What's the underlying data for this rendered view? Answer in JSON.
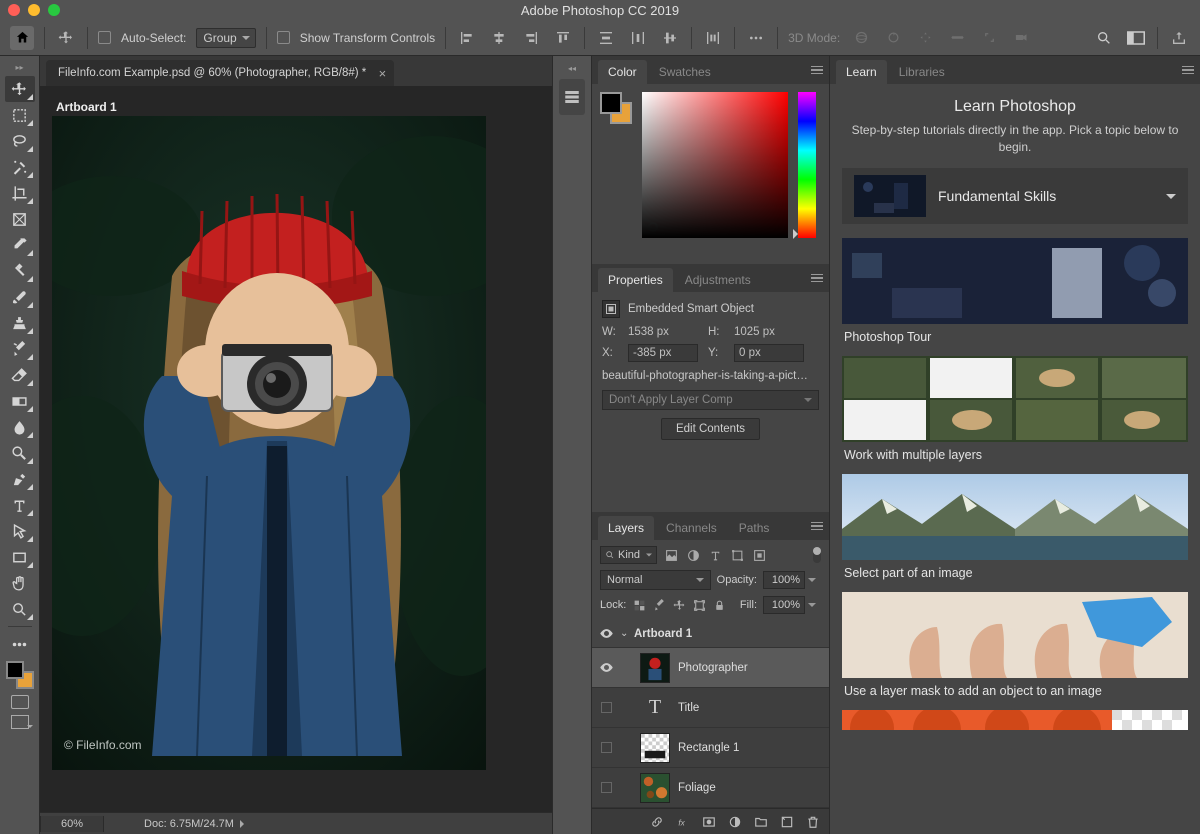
{
  "title": "Adobe Photoshop CC 2019",
  "option_bar": {
    "auto_select_label": "Auto-Select:",
    "auto_select_value": "Group",
    "show_transform_label": "Show Transform Controls",
    "mode_3d_label": "3D Mode:"
  },
  "document": {
    "tab_title": "FileInfo.com Example.psd @ 60% (Photographer, RGB/8#) *",
    "artboard_label": "Artboard 1",
    "watermark": "© FileInfo.com",
    "zoom": "60%",
    "docsize": "Doc: 6.75M/24.7M"
  },
  "panels": {
    "color_tab": "Color",
    "swatches_tab": "Swatches",
    "properties_tab": "Properties",
    "adjustments_tab": "Adjustments",
    "layers_tab": "Layers",
    "channels_tab": "Channels",
    "paths_tab": "Paths",
    "learn_tab": "Learn",
    "libraries_tab": "Libraries"
  },
  "properties": {
    "object_type": "Embedded Smart Object",
    "w_label": "W:",
    "w_value": "1538 px",
    "h_label": "H:",
    "h_value": "1025 px",
    "x_label": "X:",
    "x_value": "-385 px",
    "y_label": "Y:",
    "y_value": "0 px",
    "filename": "beautiful-photographer-is-taking-a-pict…",
    "layer_comp": "Don't Apply Layer Comp",
    "edit_btn": "Edit Contents"
  },
  "layers": {
    "filter_label": "Kind",
    "blend_mode": "Normal",
    "opacity_label": "Opacity:",
    "opacity_value": "100%",
    "lock_label": "Lock:",
    "fill_label": "Fill:",
    "fill_value": "100%",
    "items": [
      {
        "name": "Artboard 1"
      },
      {
        "name": "Photographer"
      },
      {
        "name": "Title"
      },
      {
        "name": "Rectangle 1"
      },
      {
        "name": "Foliage"
      }
    ]
  },
  "learn": {
    "heading": "Learn Photoshop",
    "subheading": "Step-by-step tutorials directly in the app. Pick a topic below to begin.",
    "accordion": "Fundamental Skills",
    "cards": [
      "Photoshop Tour",
      "Work with multiple layers",
      "Select part of an image",
      "Use a layer mask to add an object to an image"
    ]
  }
}
